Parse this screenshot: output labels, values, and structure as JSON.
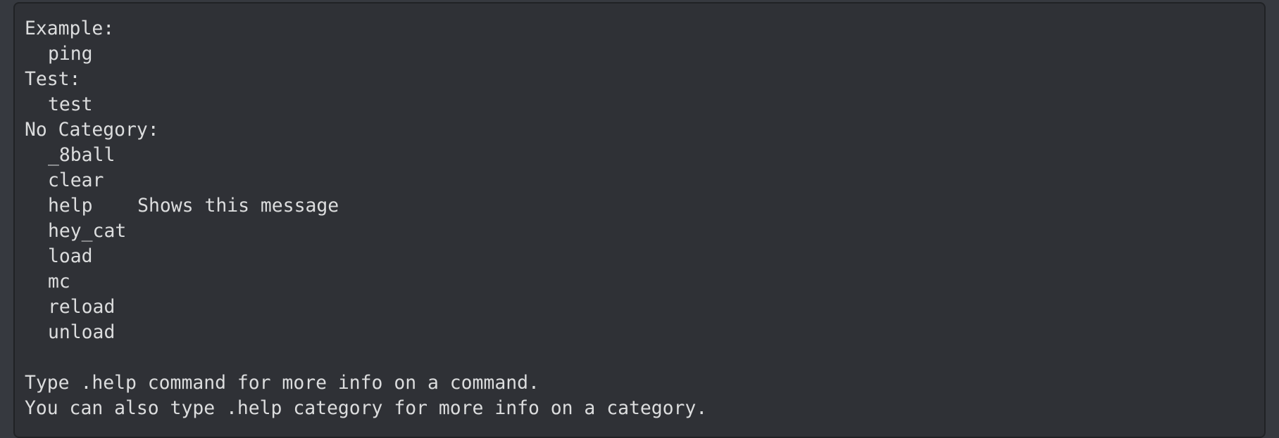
{
  "help_output": {
    "categories": [
      {
        "heading": "Example:",
        "commands": [
          {
            "name": "ping",
            "desc": ""
          }
        ]
      },
      {
        "heading": "Test:",
        "commands": [
          {
            "name": "test",
            "desc": ""
          }
        ]
      },
      {
        "heading": "No Category:",
        "commands": [
          {
            "name": "_8ball",
            "desc": ""
          },
          {
            "name": "clear",
            "desc": ""
          },
          {
            "name": "help",
            "desc": "Shows this message"
          },
          {
            "name": "hey_cat",
            "desc": ""
          },
          {
            "name": "load",
            "desc": ""
          },
          {
            "name": "mc",
            "desc": ""
          },
          {
            "name": "reload",
            "desc": ""
          },
          {
            "name": "unload",
            "desc": ""
          }
        ]
      }
    ],
    "footer": [
      "Type .help command for more info on a command.",
      "You can also type .help category for more info on a category."
    ]
  },
  "colors": {
    "background": "#36393f",
    "codeblock_bg": "#2f3136",
    "text": "#dcddde"
  }
}
